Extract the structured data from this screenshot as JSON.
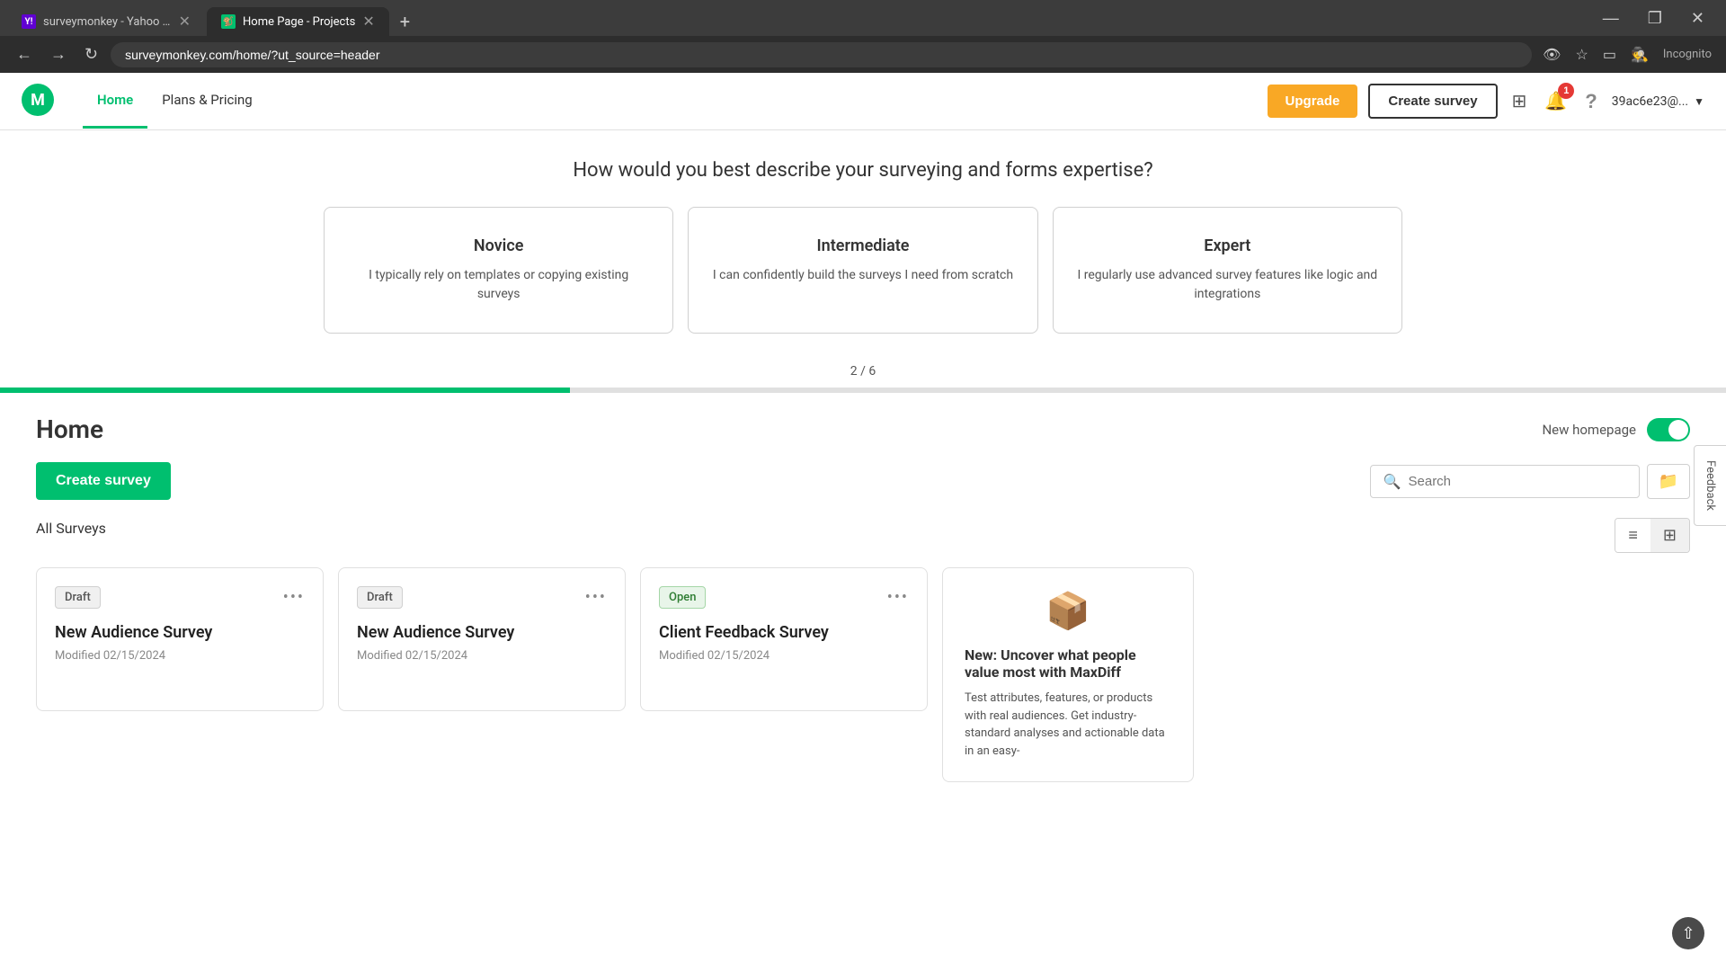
{
  "browser": {
    "url": "surveymonkey.com/home/?ut_source=header",
    "tabs": [
      {
        "id": "yahoo",
        "label": "surveymonkey - Yahoo Search",
        "favicon_type": "yahoo",
        "active": false
      },
      {
        "id": "home",
        "label": "Home Page - Projects",
        "favicon_type": "monkey",
        "active": true
      }
    ],
    "new_tab_symbol": "+",
    "window_controls": [
      "—",
      "❐",
      "✕"
    ]
  },
  "header": {
    "logo_alt": "SurveyMonkey",
    "nav": [
      {
        "id": "home",
        "label": "Home",
        "active": true
      },
      {
        "id": "pricing",
        "label": "Plans & Pricing",
        "active": false
      }
    ],
    "upgrade_label": "Upgrade",
    "create_survey_label": "Create survey",
    "notification_count": "1",
    "user_email": "39ac6e23@..."
  },
  "expertise": {
    "title": "How would you best describe your surveying and forms expertise?",
    "cards": [
      {
        "id": "novice",
        "title": "Novice",
        "desc": "I typically rely on templates or copying existing surveys"
      },
      {
        "id": "intermediate",
        "title": "Intermediate",
        "desc": "I can confidently build the surveys I need from scratch"
      },
      {
        "id": "expert",
        "title": "Expert",
        "desc": "I regularly use advanced survey features like logic and integrations"
      }
    ]
  },
  "progress": {
    "label": "2 / 6",
    "percent": 33
  },
  "home": {
    "title": "Home",
    "new_homepage_label": "New homepage",
    "create_survey_label": "Create survey",
    "search_placeholder": "Search",
    "all_surveys_label": "All Surveys"
  },
  "surveys": [
    {
      "id": "1",
      "badge": "Draft",
      "badge_type": "draft",
      "title": "New Audience Survey",
      "modified": "Modified 02/15/2024"
    },
    {
      "id": "2",
      "badge": "Draft",
      "badge_type": "draft",
      "title": "New Audience Survey",
      "modified": "Modified 02/15/2024"
    },
    {
      "id": "3",
      "badge": "Open",
      "badge_type": "open",
      "title": "Client Feedback Survey",
      "modified": "Modified 02/15/2024"
    }
  ],
  "promo": {
    "title": "New: Uncover what people value most with MaxDiff",
    "desc": "Test attributes, features, or products with real audiences. Get industry-standard analyses and actionable data in an easy-"
  },
  "feedback_label": "Feedback"
}
